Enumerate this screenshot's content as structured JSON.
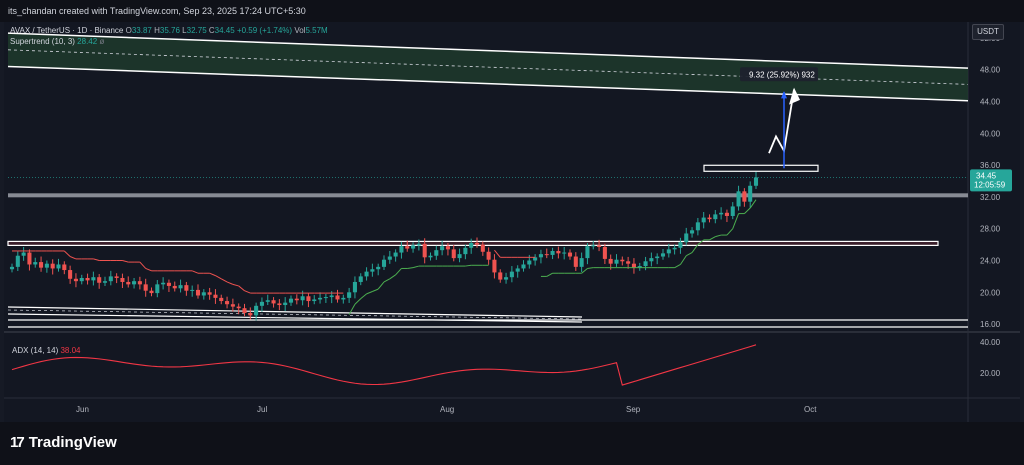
{
  "header": {
    "author_line": "its_chandan created with TradingView.com, Sep 23, 2025 17:24 UTC+5:30"
  },
  "legend": {
    "symbol": "AVAX / TetherUS · 1D · Binance",
    "open_label": "O",
    "open": "33.87",
    "high_label": "H",
    "high": "35.76",
    "low_label": "L",
    "low": "32.75",
    "close_label": "C",
    "close": "34.45",
    "change": "+0.59 (+1.74%)",
    "vol_label": "Vol",
    "vol": "5.57M",
    "supertrend_label": "Supertrend (10, 3)",
    "supertrend_value": "28.42",
    "supertrend_icon": "eye-slash-icon"
  },
  "currency_button": "USDT",
  "price_axis": [
    "52.00",
    "48.00",
    "44.00",
    "40.00",
    "36.00",
    "32.00",
    "28.00",
    "24.00",
    "20.00",
    "16.00"
  ],
  "price_badge": {
    "price": "34.45",
    "countdown": "12:05:59"
  },
  "measure_label": "9.32 (25.92%) 932",
  "adx": {
    "label": "ADX (14, 14)",
    "value": "38.04",
    "axis": [
      "40.00",
      "20.00"
    ]
  },
  "time_axis": [
    "Jun",
    "Jul",
    "Aug",
    "Sep",
    "Oct"
  ],
  "footer": {
    "brand": "TradingView"
  },
  "colors": {
    "up": "#26a69a",
    "down": "#ef5350",
    "adx": "#f23645",
    "band": "#1e3a2c",
    "bg": "#131722"
  },
  "chart_data": {
    "type": "candlestick",
    "title": "AVAX / TetherUS · 1D · Binance",
    "y_range": [
      14,
      54
    ],
    "x_labels": [
      "Jun",
      "Jul",
      "Aug",
      "Sep",
      "Oct"
    ],
    "series": [
      {
        "name": "AVAX / TetherUS",
        "close": [
          23.2,
          24.6,
          25.0,
          23.5,
          23.8,
          23.1,
          23.6,
          23.0,
          23.5,
          22.8,
          21.7,
          21.4,
          21.8,
          21.5,
          21.9,
          21.2,
          21.4,
          22.0,
          21.8,
          21.3,
          21.0,
          21.4,
          21.0,
          20.2,
          19.9,
          21.0,
          21.2,
          20.8,
          20.5,
          20.9,
          20.2,
          20.3,
          19.6,
          20.0,
          19.7,
          19.3,
          18.9,
          18.5,
          18.2,
          18.0,
          17.4,
          17.1,
          18.3,
          18.8,
          19.0,
          18.6,
          18.4,
          18.7,
          19.2,
          19.0,
          19.5,
          18.9,
          19.1,
          19.3,
          19.4,
          19.6,
          19.1,
          19.3,
          20.0,
          21.3,
          22.0,
          22.6,
          22.9,
          23.2,
          24.1,
          24.5,
          25.0,
          25.8,
          25.5,
          25.9,
          26.1,
          24.4,
          24.6,
          25.3,
          25.8,
          25.4,
          24.3,
          24.8,
          25.6,
          26.2,
          26.0,
          25.1,
          24.1,
          22.5,
          21.6,
          21.9,
          22.6,
          23.0,
          23.5,
          24.0,
          24.4,
          24.8,
          24.7,
          25.2,
          24.9,
          25.0,
          24.5,
          23.2,
          24.3,
          25.8,
          25.9,
          25.7,
          24.2,
          23.6,
          24.1,
          23.9,
          23.6,
          23.1,
          23.3,
          23.9,
          24.3,
          24.5,
          24.9,
          25.4,
          25.6,
          26.3,
          27.4,
          27.8,
          28.8,
          29.4,
          29.2,
          29.8,
          30.0,
          29.6,
          30.8,
          32.7,
          31.4,
          33.4,
          34.45
        ]
      },
      {
        "name": "Supertrend (10, 3)",
        "value": 28.42
      },
      {
        "name": "ADX (14, 14)",
        "value": 38.04
      }
    ],
    "annotations": {
      "upper_channel": {
        "start": 52.6,
        "end": 48.2,
        "lower_start": 48.4,
        "lower_end": 44.1
      },
      "resistance_box": 35.6,
      "support_level": 32.2,
      "range_box": [
        25.9,
        26.4
      ],
      "measure": "9.32 (25.92%) 932"
    }
  }
}
